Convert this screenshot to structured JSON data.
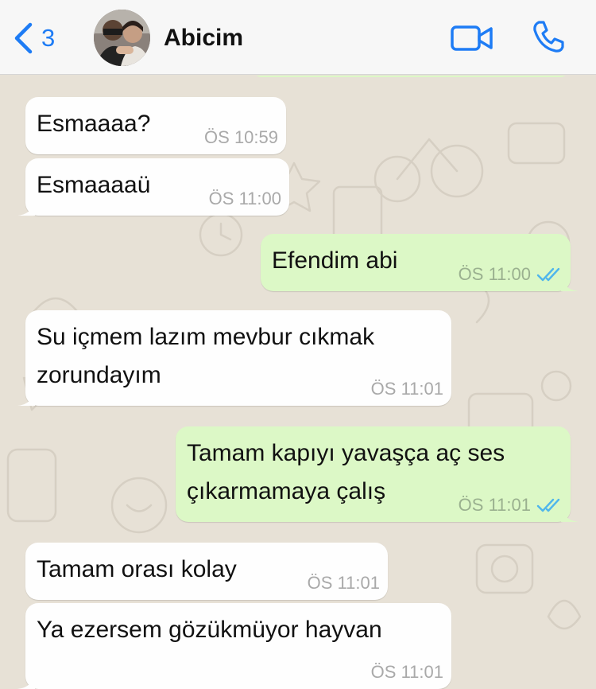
{
  "header": {
    "back_count": "3",
    "contact_name": "Abicim",
    "avatar_icon": "contact-photo",
    "video_icon": "video-camera-icon",
    "call_icon": "phone-icon",
    "accent_color": "#1e7cf5"
  },
  "colors": {
    "chat_background": "#e7e1d6",
    "incoming_bubble": "#fefefe",
    "outgoing_bubble": "#dcf8c6",
    "read_ticks": "#4fb6ec"
  },
  "messages": [
    {
      "direction": "incoming",
      "lines": [
        "Esmaaaa?"
      ],
      "time": "ÖS 10:59"
    },
    {
      "direction": "incoming",
      "lines": [
        "Esmaaaaü"
      ],
      "time": "ÖS 11:00"
    },
    {
      "direction": "outgoing",
      "lines": [
        "Efendim abi"
      ],
      "time": "ÖS 11:00",
      "status": "read"
    },
    {
      "direction": "incoming",
      "lines": [
        "Su içmem lazım mevbur cıkmak",
        "zorundayım"
      ],
      "time": "ÖS 11:01"
    },
    {
      "direction": "outgoing",
      "lines": [
        "Tamam kapıyı yavaşça aç ses",
        "çıkarmamaya çalış"
      ],
      "time": "ÖS 11:01",
      "status": "read"
    },
    {
      "direction": "incoming",
      "lines": [
        "Tamam orası kolay"
      ],
      "time": "ÖS 11:01"
    },
    {
      "direction": "incoming",
      "lines": [
        "Ya ezersem gözükmüyor hayvan"
      ],
      "time": "ÖS 11:01"
    }
  ]
}
